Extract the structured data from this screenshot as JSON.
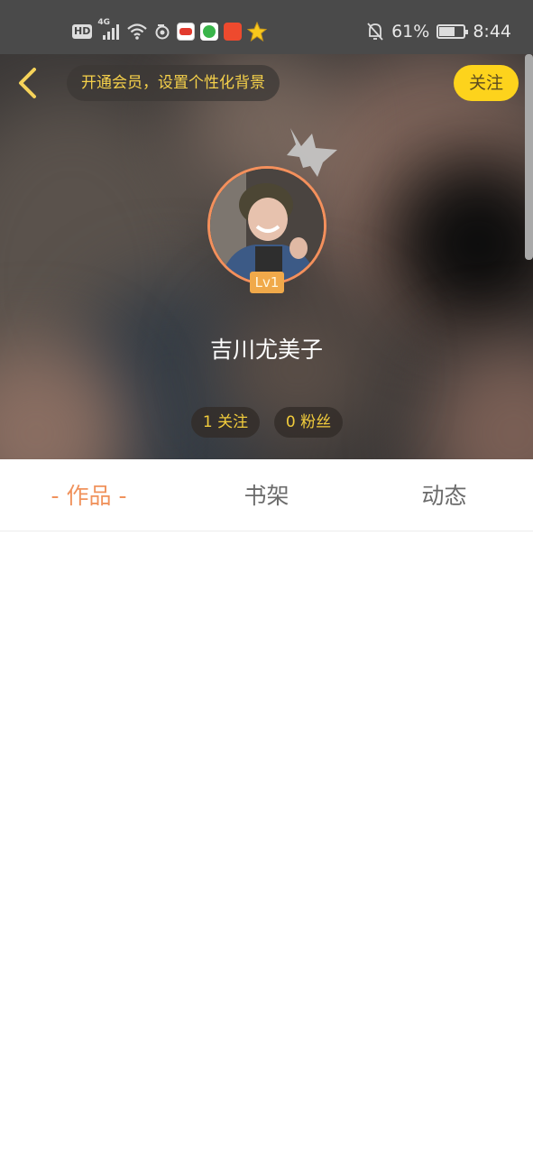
{
  "status_bar": {
    "network_badge": "HD",
    "network_type": "4G",
    "battery_percent": "61%",
    "battery_level": 0.61,
    "time": "8:44"
  },
  "nav": {
    "back_icon": "chevron-left-icon",
    "vip_prompt": "开通会员，设置个性化背景",
    "follow_label": "关注"
  },
  "profile": {
    "username": "吉川尤美子",
    "level": "Lv1",
    "following": "1 关注",
    "fans": "0 粉丝"
  },
  "tabs": [
    {
      "label": "- 作品 -",
      "active": true
    },
    {
      "label": "书架",
      "active": false
    },
    {
      "label": "动态",
      "active": false
    }
  ],
  "colors": {
    "accent_yellow": "#fdd31c",
    "active_tab": "#f0925c",
    "level_badge": "#f0a94a",
    "avatar_ring": "#f4905c"
  }
}
